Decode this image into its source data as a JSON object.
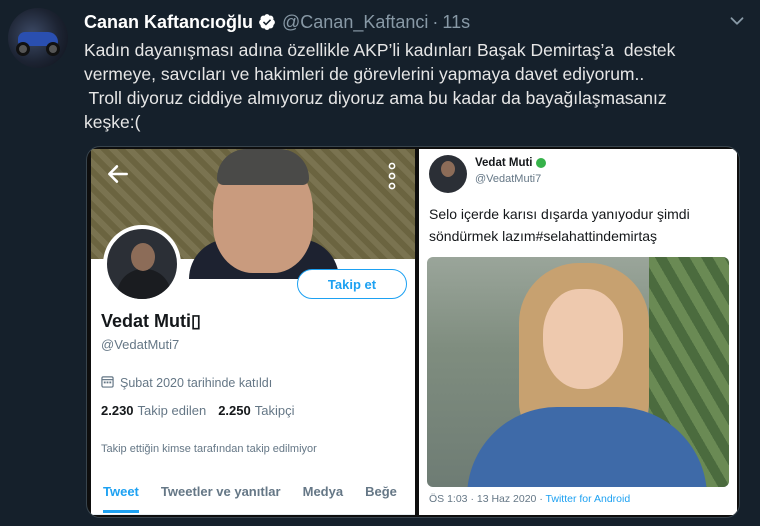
{
  "tweet": {
    "author_name": "Canan Kaftancıoğlu",
    "handle": "@Canan_Kaftanci",
    "separator": "·",
    "time": "11s",
    "lines": [
      "Kadın dayanışması adına özellikle AKP’li kadınları Başak Demirtaş’a  destek",
      "vermeye, savcıları ve hakimleri de görevlerini yapmaya davet ediyorum..",
      " Troll diyoruz ciddiye almıyoruz diyoruz ama bu kadar da bayağılaşmasanız",
      "keşke:("
    ]
  },
  "profile_screenshot": {
    "follow_label": "Takip et",
    "name": "Vedat Muti",
    "name_suffix_glyph": "▯",
    "handle": "@VedatMuti7",
    "joined": "Şubat 2020 tarihinde katıldı",
    "following_count": "2.230",
    "following_label": "Takip edilen",
    "followers_count": "2.250",
    "followers_label": "Takipçi",
    "note": "Takip ettiğin kimse tarafından takip edilmiyor",
    "tabs": [
      "Tweet",
      "Tweetler ve yanıtlar",
      "Medya",
      "Beğe"
    ]
  },
  "tweet_screenshot": {
    "name": "Vedat Muti",
    "handle": "@VedatMuti7",
    "text_line1": "Selo içerde karısı dışarda yanıyodur şimdi",
    "text_line2": "söndürmek lazım#selahattindemirtaş",
    "footer_time": "ÖS 1:03 · 13 Haz 2020 · ",
    "footer_source": "Twitter for Android"
  },
  "colors": {
    "background": "#15202b",
    "accent": "#1da1f2",
    "secondary_text": "#8899a6"
  },
  "icons": [
    "verified-badge-icon",
    "chevron-down-icon",
    "back-arrow-icon",
    "more-vertical-icon",
    "calendar-icon"
  ]
}
